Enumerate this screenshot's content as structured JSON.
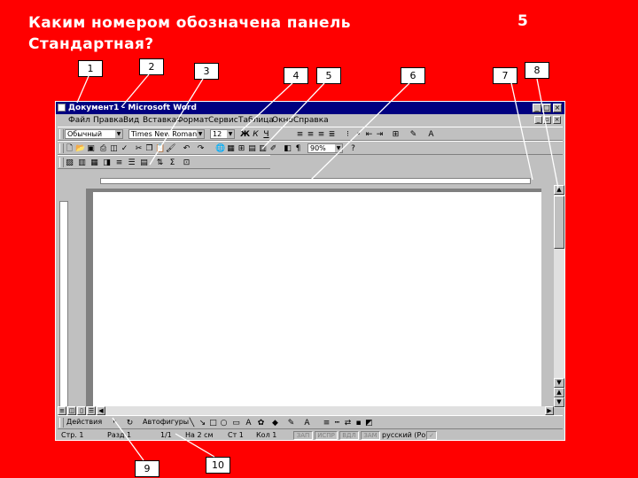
{
  "slide": {
    "question": "Каким номером обозначена панель\nСтандартная?",
    "number": "5",
    "callouts": [
      "1",
      "2",
      "3",
      "4",
      "5",
      "6",
      "7",
      "8",
      "9",
      "10"
    ]
  },
  "window": {
    "title": "Документ1 - Microsoft Word",
    "menu": [
      "Файл",
      "Правка",
      "Вид",
      "Вставка",
      "Формат",
      "Сервис",
      "Таблица",
      "Окно",
      "Справка"
    ],
    "style_value": "Обычный",
    "font_value": "Times New Roman",
    "size_value": "12",
    "zoom_value": "90%",
    "draw_label": "Действия",
    "autoshapes_label": "Автофигуры",
    "status": {
      "page": "Стр. 1",
      "section": "Разд 1",
      "pages": "1/1",
      "position": "На 2 см",
      "line": "Ст 1",
      "column": "Кол 1",
      "rec": "ЗАП",
      "trk": "ИСПР",
      "ext": "ВДЛ",
      "ovr": "ЗАМ",
      "lang": "русский (Ро"
    }
  },
  "colors": {
    "background": "#ff0000",
    "titlebar": "#000080",
    "chrome": "#c0c0c0"
  }
}
